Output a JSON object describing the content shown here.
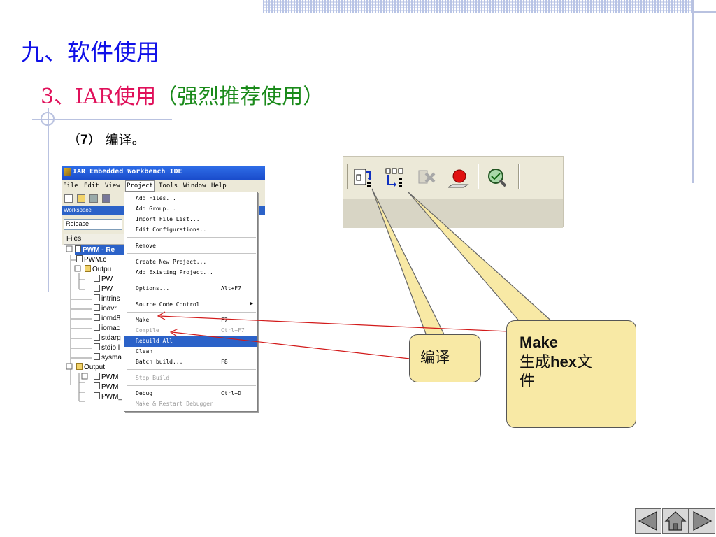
{
  "slide": {
    "title": "九、软件使用",
    "subtitle_prefix": "3、IAR使用",
    "subtitle_suffix": "（强烈推荐使用）",
    "step_open": "（",
    "step_number": "7",
    "step_close": "）",
    "step_text": "编译。",
    "accent_color": "#1010e8",
    "subtitle_red": "#e0105a",
    "subtitle_green": "#1a8a1a"
  },
  "ide": {
    "window_title": "IAR Embedded Workbench IDE",
    "menu": [
      "File",
      "Edit",
      "View",
      "Project",
      "Tools",
      "Window",
      "Help"
    ],
    "workspace_label": "Workspace",
    "config": "Release",
    "files_header": "Files",
    "tree": [
      {
        "label": "PWM - Re",
        "type": "project",
        "selected": true
      },
      {
        "label": "PWM.c",
        "type": "file"
      },
      {
        "label": "Outpu",
        "type": "folder"
      },
      {
        "label": "PW",
        "type": "file"
      },
      {
        "label": "PW",
        "type": "file"
      },
      {
        "label": "intrins",
        "type": "file"
      },
      {
        "label": "ioavr.",
        "type": "file"
      },
      {
        "label": "iom48",
        "type": "file"
      },
      {
        "label": "iomac",
        "type": "file"
      },
      {
        "label": "stdarg",
        "type": "file"
      },
      {
        "label": "stdio.l",
        "type": "file"
      },
      {
        "label": "sysma",
        "type": "file"
      },
      {
        "label": "Output",
        "type": "folder"
      },
      {
        "label": "PWM",
        "type": "file"
      },
      {
        "label": "PWM",
        "type": "file"
      },
      {
        "label": "PWM_",
        "type": "file"
      }
    ],
    "project_menu": [
      {
        "label": "Add Files...",
        "shortcut": ""
      },
      {
        "label": "Add Group...",
        "shortcut": ""
      },
      {
        "label": "Import File List...",
        "shortcut": ""
      },
      {
        "label": "Edit Configurations...",
        "shortcut": ""
      },
      {
        "label": "Remove",
        "shortcut": ""
      },
      {
        "label": "Create New Project...",
        "shortcut": ""
      },
      {
        "label": "Add Existing Project...",
        "shortcut": ""
      },
      {
        "label": "Options...",
        "shortcut": "Alt+F7"
      },
      {
        "label": "Source Code Control",
        "shortcut": ""
      },
      {
        "label": "Make",
        "shortcut": "F7"
      },
      {
        "label": "Compile",
        "shortcut": "Ctrl+F7"
      },
      {
        "label": "Rebuild All",
        "shortcut": ""
      },
      {
        "label": "Clean",
        "shortcut": ""
      },
      {
        "label": "Batch build...",
        "shortcut": "F8"
      },
      {
        "label": "Stop Build",
        "shortcut": ""
      },
      {
        "label": "Debug",
        "shortcut": "Ctrl+D"
      },
      {
        "label": "Make & Restart Debugger",
        "shortcut": ""
      }
    ]
  },
  "toolbar_icons": [
    "compile-icon",
    "make-icon",
    "stop-build-icon",
    "breakpoint-icon",
    "debug-icon"
  ],
  "callouts": {
    "compile": "编译",
    "make_line1": "Make",
    "make_line2_a": "生成",
    "make_line2_b": "hex",
    "make_line2_c": "文",
    "make_line3": "件",
    "fill_color": "#f8e9a5"
  }
}
